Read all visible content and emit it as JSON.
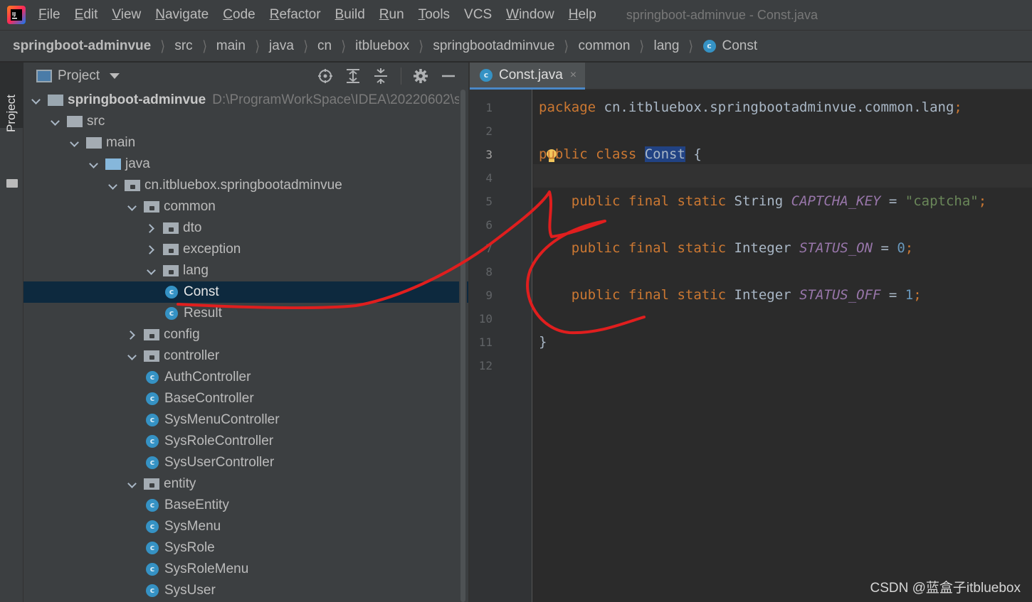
{
  "menubar": {
    "items": [
      {
        "mnemonic": "F",
        "rest": "ile"
      },
      {
        "mnemonic": "E",
        "rest": "dit"
      },
      {
        "mnemonic": "V",
        "rest": "iew"
      },
      {
        "mnemonic": "N",
        "rest": "avigate"
      },
      {
        "mnemonic": "C",
        "rest": "ode"
      },
      {
        "mnemonic": "R",
        "rest": "efactor"
      },
      {
        "mnemonic": "B",
        "rest": "uild"
      },
      {
        "mnemonic": "R",
        "rest": "u",
        "tail": "n"
      },
      {
        "mnemonic": "T",
        "rest": "ools"
      },
      {
        "mnemonic": "",
        "rest": "VCS"
      },
      {
        "mnemonic": "W",
        "rest": "indow"
      },
      {
        "mnemonic": "H",
        "rest": "elp"
      }
    ],
    "window_title": "springboot-adminvue - Const.java",
    "app_icon": "intellij-idea-icon"
  },
  "breadcrumb": {
    "items": [
      "springboot-adminvue",
      "src",
      "main",
      "java",
      "cn",
      "itbluebox",
      "springbootadminvue",
      "common",
      "lang",
      "Const"
    ]
  },
  "toolstrip": {
    "project_tab_label": "Project"
  },
  "project_panel": {
    "title": "Project",
    "tree": [
      {
        "label": "springboot-adminvue",
        "path": "D:\\ProgramWorkSpace\\IDEA\\20220602\\s",
        "type": "module",
        "expanded": true
      },
      {
        "label": "src",
        "type": "folder",
        "expanded": true
      },
      {
        "label": "main",
        "type": "folder",
        "expanded": true
      },
      {
        "label": "java",
        "type": "source",
        "expanded": true
      },
      {
        "label": "cn.itbluebox.springbootadminvue",
        "type": "package",
        "expanded": true
      },
      {
        "label": "common",
        "type": "package",
        "expanded": true
      },
      {
        "label": "dto",
        "type": "package",
        "expanded": false
      },
      {
        "label": "exception",
        "type": "package",
        "expanded": false
      },
      {
        "label": "lang",
        "type": "package",
        "expanded": true
      },
      {
        "label": "Const",
        "type": "class",
        "selected": true
      },
      {
        "label": "Result",
        "type": "class"
      },
      {
        "label": "config",
        "type": "package",
        "expanded": false
      },
      {
        "label": "controller",
        "type": "package",
        "expanded": true
      },
      {
        "label": "AuthController",
        "type": "class"
      },
      {
        "label": "BaseController",
        "type": "class"
      },
      {
        "label": "SysMenuController",
        "type": "class"
      },
      {
        "label": "SysRoleController",
        "type": "class"
      },
      {
        "label": "SysUserController",
        "type": "class"
      },
      {
        "label": "entity",
        "type": "package",
        "expanded": true
      },
      {
        "label": "BaseEntity",
        "type": "class"
      },
      {
        "label": "SysMenu",
        "type": "class"
      },
      {
        "label": "SysRole",
        "type": "class"
      },
      {
        "label": "SysRoleMenu",
        "type": "class"
      },
      {
        "label": "SysUser",
        "type": "class"
      }
    ]
  },
  "editor": {
    "tab_label": "Const.java",
    "tab_close": "×",
    "current_line": 3,
    "lines": [
      {
        "n": "1",
        "tokens": [
          {
            "t": "package ",
            "c": "kw"
          },
          {
            "t": "cn.itbluebox.springbootadminvue.common.lang",
            "c": ""
          },
          {
            "t": ";",
            "c": "kw"
          }
        ]
      },
      {
        "n": "2",
        "tokens": []
      },
      {
        "n": "3",
        "tokens": [
          {
            "t": "public class ",
            "c": "kw"
          },
          {
            "t": "Const",
            "c": "sel-ident"
          },
          {
            "t": " {",
            "c": ""
          }
        ]
      },
      {
        "n": "4",
        "tokens": []
      },
      {
        "n": "5",
        "tokens": [
          {
            "t": "    public final static ",
            "c": "kw"
          },
          {
            "t": "String ",
            "c": ""
          },
          {
            "t": "CAPTCHA_KEY",
            "c": "const-field"
          },
          {
            "t": " = ",
            "c": ""
          },
          {
            "t": "\"captcha\"",
            "c": "str"
          },
          {
            "t": ";",
            "c": "kw"
          }
        ]
      },
      {
        "n": "6",
        "tokens": []
      },
      {
        "n": "7",
        "tokens": [
          {
            "t": "    public final static ",
            "c": "kw"
          },
          {
            "t": "Integer ",
            "c": ""
          },
          {
            "t": "STATUS_ON",
            "c": "const-field"
          },
          {
            "t": " = ",
            "c": ""
          },
          {
            "t": "0",
            "c": "num"
          },
          {
            "t": ";",
            "c": "kw"
          }
        ]
      },
      {
        "n": "8",
        "tokens": []
      },
      {
        "n": "9",
        "tokens": [
          {
            "t": "    public final static ",
            "c": "kw"
          },
          {
            "t": "Integer ",
            "c": ""
          },
          {
            "t": "STATUS_OFF",
            "c": "const-field"
          },
          {
            "t": " = ",
            "c": ""
          },
          {
            "t": "1",
            "c": "num"
          },
          {
            "t": ";",
            "c": "kw"
          }
        ]
      },
      {
        "n": "10",
        "tokens": []
      },
      {
        "n": "11",
        "tokens": [
          {
            "t": "}",
            "c": ""
          }
        ]
      },
      {
        "n": "12",
        "tokens": []
      }
    ]
  },
  "watermark": "CSDN @蓝盒子itbluebox",
  "colors": {
    "annotation_stroke": "#e01e1e",
    "selection": "#0d293e",
    "keyword": "#cc7832",
    "string": "#6a8759",
    "number": "#6897bb",
    "constant": "#9876aa"
  }
}
